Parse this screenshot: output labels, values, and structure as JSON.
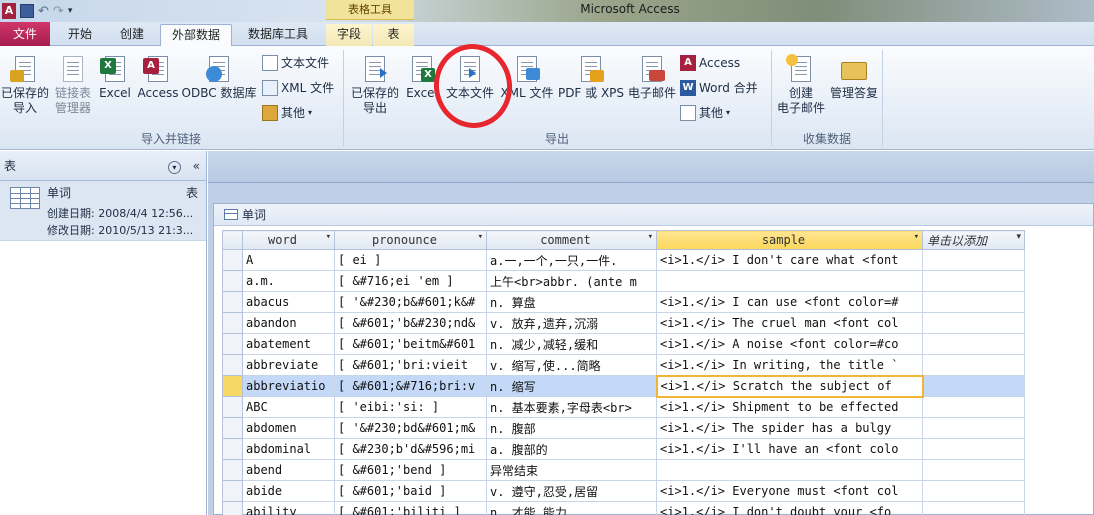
{
  "window": {
    "title": "Microsoft Access"
  },
  "qat": {
    "app_icon": "A",
    "save_icon": "save-icon",
    "undo_icon": "undo-icon",
    "redo_icon": "redo-icon"
  },
  "contextual": {
    "title": "表格工具"
  },
  "tabs": [
    {
      "label": "文件"
    },
    {
      "label": "开始"
    },
    {
      "label": "创建"
    },
    {
      "label": "外部数据"
    },
    {
      "label": "数据库工具"
    },
    {
      "label": "字段"
    },
    {
      "label": "表"
    }
  ],
  "ribbon": {
    "import_group": {
      "label": "导入并链接",
      "saved_import": "已保存的\n导入",
      "linked_table_manager": "链接表\n管理器",
      "excel": "Excel",
      "access": "Access",
      "odbc": "ODBC 数据库",
      "text_file": "文本文件",
      "xml_file": "XML 文件",
      "other": "其他"
    },
    "export_group": {
      "label": "导出",
      "saved_export": "已保存的\n导出",
      "excel": "Excel",
      "text_file": "文本文件",
      "xml_file": "XML 文件",
      "pdf_xps": "PDF 或 XPS",
      "email": "电子邮件",
      "access": "Access",
      "word_merge": "Word 合并",
      "other": "其他"
    },
    "collect_group": {
      "label": "收集数据",
      "create_email": "创建\n电子邮件",
      "manage_replies": "管理答复"
    }
  },
  "nav": {
    "header": "表",
    "item": {
      "name": "单词",
      "type": "表",
      "created": "创建日期: 2008/4/4 12:56...",
      "modified": "修改日期: 2010/5/13 21:3..."
    }
  },
  "datasheet": {
    "title": "单词",
    "columns": [
      "word",
      "pronounce",
      "comment",
      "sample",
      "单击以添加"
    ],
    "rows": [
      [
        "A",
        "[ ei ]",
        "a.一,一个,一只,一件.",
        "<i>1.</i> I don't care what <font",
        ""
      ],
      [
        "a.m.",
        "[ &#716;ei 'em ]",
        "上午<br>abbr. (ante m",
        "",
        ""
      ],
      [
        "abacus",
        "[ '&#230;b&#601;k&#",
        "n. 算盘",
        "<i>1.</i> I can use <font color=#",
        ""
      ],
      [
        "abandon",
        "[ &#601;'b&#230;nd&",
        "v. 放弃,遗弃,沉溺",
        "<i>1.</i> The cruel man <font col",
        ""
      ],
      [
        "abatement",
        "[ &#601;'beitm&#601",
        "n. 减少,减轻,缓和",
        "<i>1.</i> A noise <font color=#co",
        ""
      ],
      [
        "abbreviate",
        "[ &#601;'bri:vieit",
        "v. 缩写,使...简略",
        "<i>1.</i> In writing, the title `",
        ""
      ],
      [
        "abbreviatio",
        "[ &#601;&#716;bri:v",
        "n. 缩写",
        "<i>1.</i> Scratch the subject of",
        ""
      ],
      [
        "ABC",
        "[ 'eibi:'si: ]",
        "n. 基本要素,字母表<br>",
        "<i>1.</i> Shipment to be effected",
        ""
      ],
      [
        "abdomen",
        "[ '&#230;bd&#601;m&",
        "n. 腹部",
        "<i>1.</i> The spider has a bulgy",
        ""
      ],
      [
        "abdominal",
        "[ &#230;b'd&#596;mi",
        "a. 腹部的",
        "<i>1.</i> I'll have an <font colo",
        ""
      ],
      [
        "abend",
        "[ &#601;'bend ]",
        "异常结束",
        "",
        ""
      ],
      [
        "abide",
        "[ &#601;'baid ]",
        "v. 遵守,忍受,居留",
        "<i>1.</i> Everyone must <font col",
        ""
      ],
      [
        "ability",
        "[ &#601;'biliti ]",
        "n. 才能,能力",
        "<i>1.</i> I don't doubt your <fo",
        ""
      ]
    ],
    "current_row": 6
  },
  "colors": {
    "file_tab": "#b8245a",
    "selected_header": "#fbd75a",
    "selected_row": "#c3d9f7",
    "annotation_circle": "#e8262e"
  }
}
